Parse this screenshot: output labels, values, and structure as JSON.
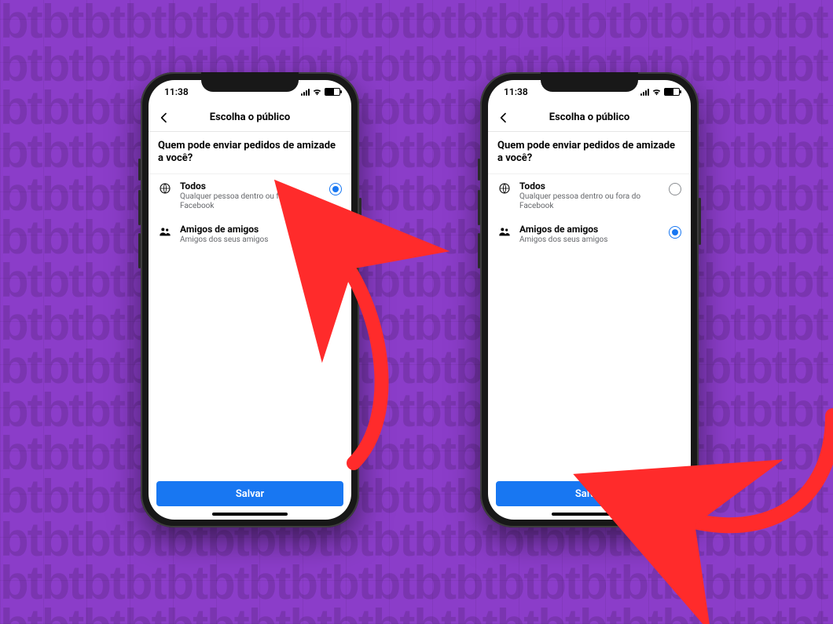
{
  "status": {
    "time": "11:38"
  },
  "header": {
    "title": "Escolha o público"
  },
  "question": "Quem pode enviar pedidos de amizade a você?",
  "options": {
    "everyone": {
      "icon": "public-icon",
      "label": "Todos",
      "desc": "Qualquer pessoa dentro ou fora do Facebook"
    },
    "fof": {
      "icon": "friends-icon",
      "label": "Amigos de amigos",
      "desc": "Amigos dos seus amigos"
    }
  },
  "phones": {
    "left": {
      "selected": "everyone"
    },
    "right": {
      "selected": "fof"
    }
  },
  "buttons": {
    "save": "Salvar"
  },
  "colors": {
    "accent": "#1877f2",
    "arrow": "#ff2b2b",
    "bg": "#8b3dc9"
  }
}
